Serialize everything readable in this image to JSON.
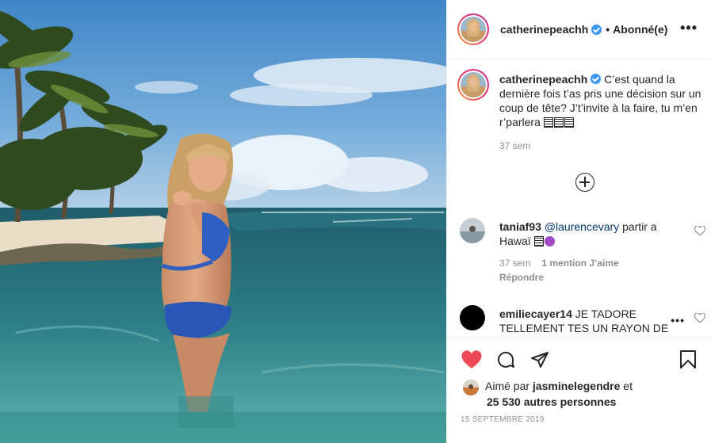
{
  "post": {
    "author": "catherinepeachh",
    "follow_separator": "•",
    "follow_status": "Abonné(e)",
    "more_label": "•••"
  },
  "caption": {
    "username": "catherinepeachh",
    "text": "C’est quand la dernière fois t’as pris une décision sur un coup de tête? J’t’invite à la faire, tu m’en r’parlera",
    "time": "37 sem"
  },
  "comments": [
    {
      "username": "taniaf93",
      "mention": "@laurencevary",
      "text": " partir a Hawaï",
      "time": "37 sem",
      "likes": "1 mention J’aime",
      "reply_label": "Répondre"
    },
    {
      "username": "emiliecayer14",
      "text": "JE TADORE TELLEMENT TES UN RAYON DE"
    }
  ],
  "likes": {
    "prefix": "Aimé par ",
    "user": "jasminelegendre",
    "suffix": " et",
    "others": "25 530 autres personnes"
  },
  "date": "15 SEPTEMBRE 2019",
  "colors": {
    "verified": "#3897f0",
    "like_red": "#ed4956",
    "meta_gray": "#8e8e8e",
    "mention_blue": "#00376b"
  },
  "icons": [
    "heart-icon",
    "comment-icon",
    "share-icon",
    "bookmark-icon",
    "plus-circle-icon",
    "verified-icon"
  ]
}
